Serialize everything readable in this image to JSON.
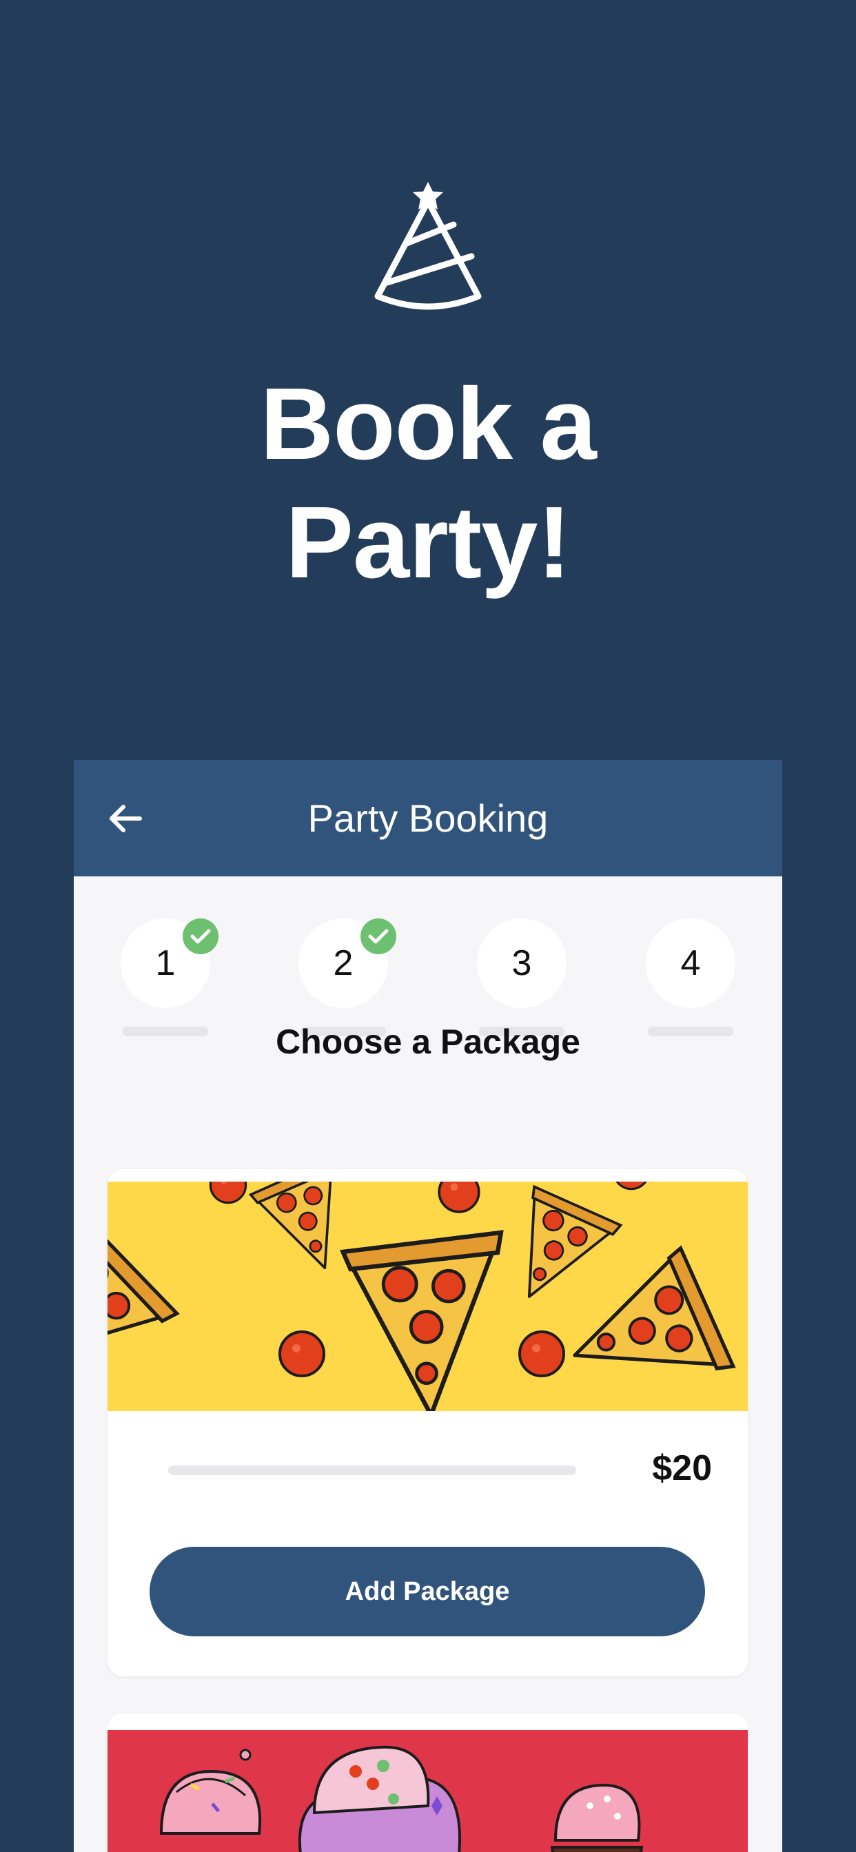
{
  "hero": {
    "icon": "party-hat-icon",
    "title_line1": "Book a",
    "title_line2": "Party!"
  },
  "header": {
    "back_icon": "arrow-left-icon",
    "title": "Party Booking"
  },
  "steps": [
    {
      "label": "1",
      "completed": true
    },
    {
      "label": "2",
      "completed": true
    },
    {
      "label": "3",
      "completed": false
    },
    {
      "label": "4",
      "completed": false
    }
  ],
  "section_title": "Choose a Package",
  "packages": [
    {
      "image": "pizza-illustration",
      "price": "$20",
      "button_label": "Add Package"
    },
    {
      "image": "cupcake-illustration"
    }
  ],
  "colors": {
    "background": "#233c5a",
    "header": "#30547c",
    "check": "#6cc070",
    "pizza_bg": "#ffd84a",
    "cupcake_bg": "#e0364a"
  }
}
